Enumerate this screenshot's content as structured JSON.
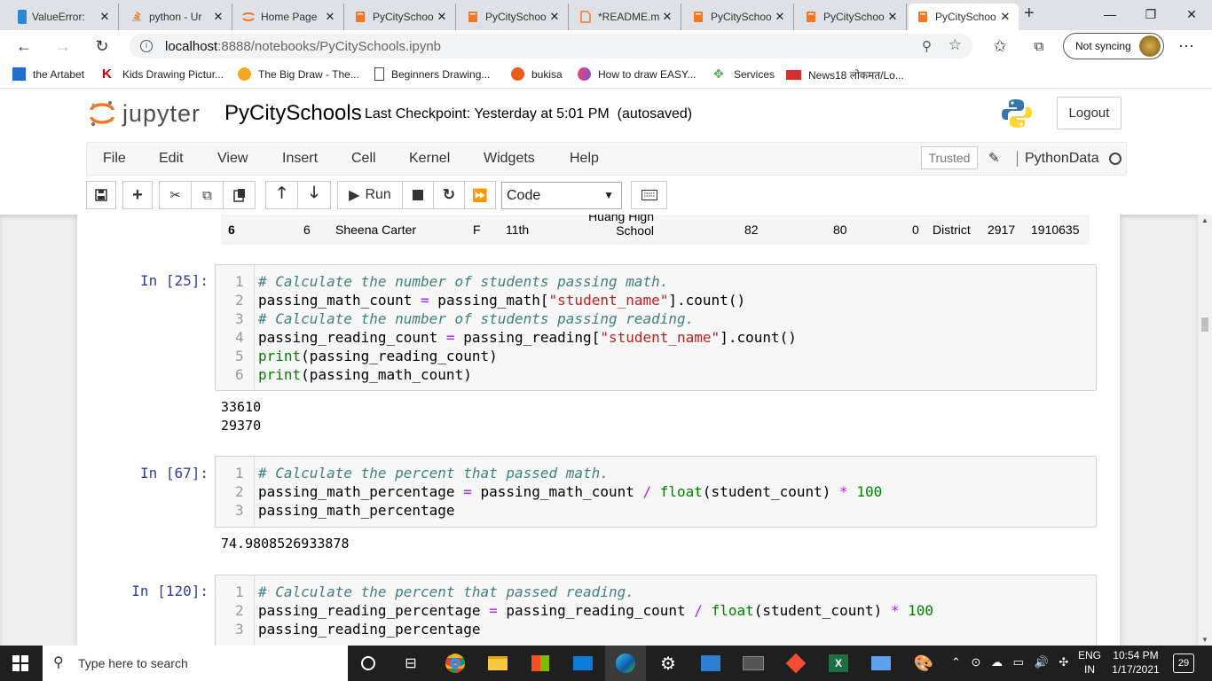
{
  "browser": {
    "tabs": [
      {
        "title": "ValueError:",
        "icon_color": "#4285f4"
      },
      {
        "title": "python - Ur",
        "icon_color": "#f48024"
      },
      {
        "title": "Home Page",
        "icon_color": "#f37726"
      },
      {
        "title": "PyCitySchoo",
        "icon_color": "#f37726"
      },
      {
        "title": "PyCitySchoo",
        "icon_color": "#f37726"
      },
      {
        "title": "*README.m",
        "icon_color": "#f37726"
      },
      {
        "title": "PyCitySchoo",
        "icon_color": "#f37726"
      },
      {
        "title": "PyCitySchoo",
        "icon_color": "#f37726"
      },
      {
        "title": "PyCitySchoo",
        "icon_color": "#f37726",
        "active": true
      }
    ],
    "new_tab": "+",
    "url_host": "localhost",
    "url_path": ":8888/notebooks/PyCitySchools.ipynb",
    "sync_label": "Not syncing",
    "bookmarks": [
      "the Artabet",
      "Kids Drawing Pictur...",
      "The Big Draw - The...",
      "Beginners Drawing...",
      "bukisa",
      "How to draw EASY...",
      "Services",
      "News18 लोकमत/Lo..."
    ]
  },
  "jupyter": {
    "logo_word": "jupyter",
    "notebook_name": "PyCitySchools",
    "checkpoint": "Last Checkpoint: Yesterday at 5:01 PM",
    "autosaved": "(autosaved)",
    "logout": "Logout",
    "menu": [
      "File",
      "Edit",
      "View",
      "Insert",
      "Cell",
      "Kernel",
      "Widgets",
      "Help"
    ],
    "trusted": "Trusted",
    "kernel_name": "PythonData",
    "run_label": "Run",
    "cell_type": "Code"
  },
  "table_row": {
    "index": "6",
    "student_id": "6",
    "student_name": "Sheena Carter",
    "gender": "F",
    "grade": "11th",
    "school_line1": "Huang High",
    "school_line2": "School",
    "reading_score": "82",
    "math_score": "80",
    "school_id": "0",
    "type": "District",
    "size": "2917",
    "budget": "1910635"
  },
  "cells": [
    {
      "prompt": "In [25]:",
      "lines": [
        "1",
        "2",
        "3",
        "4",
        "5",
        "6"
      ],
      "code": {
        "l1": "# Calculate the number of students passing math.",
        "l2_a": "passing_math_count ",
        "l2_op": "=",
        "l2_b": " passing_math[",
        "l2_s": "\"student_name\"",
        "l2_c": "].count()",
        "l3": "# Calculate the number of students passing reading.",
        "l4_a": "passing_reading_count ",
        "l4_op": "=",
        "l4_b": " passing_reading[",
        "l4_s": "\"student_name\"",
        "l4_c": "].count()",
        "l5_f": "print",
        "l5_b": "(passing_reading_count)",
        "l6_f": "print",
        "l6_b": "(passing_math_count)"
      },
      "output": [
        "33610",
        "29370"
      ]
    },
    {
      "prompt": "In [67]:",
      "lines": [
        "1",
        "2",
        "3"
      ],
      "code": {
        "l1": "# Calculate the percent that passed math.",
        "l2_a": "passing_math_percentage ",
        "l2_op": "=",
        "l2_b": " passing_math_count ",
        "l2_op2": "/",
        "l2_f": " float",
        "l2_c": "(student_count) ",
        "l2_op3": "*",
        "l2_n": " 100",
        "l3": "passing_math_percentage"
      },
      "output": [
        "74.9808526933878"
      ]
    },
    {
      "prompt": "In [120]:",
      "lines": [
        "1",
        "2",
        "3"
      ],
      "code": {
        "l1": "# Calculate the percent that passed reading.",
        "l2_a": "passing_reading_percentage ",
        "l2_op": "=",
        "l2_b": " passing_reading_count ",
        "l2_op2": "/",
        "l2_f": " float",
        "l2_c": "(student_count) ",
        "l2_op3": "*",
        "l2_n": " 100",
        "l3": "passing_reading_percentage"
      }
    }
  ],
  "taskbar": {
    "search_placeholder": "Type here to search",
    "lang1": "ENG",
    "lang2": "IN",
    "time": "10:54 PM",
    "date": "1/17/2021",
    "notif_count": "29"
  }
}
